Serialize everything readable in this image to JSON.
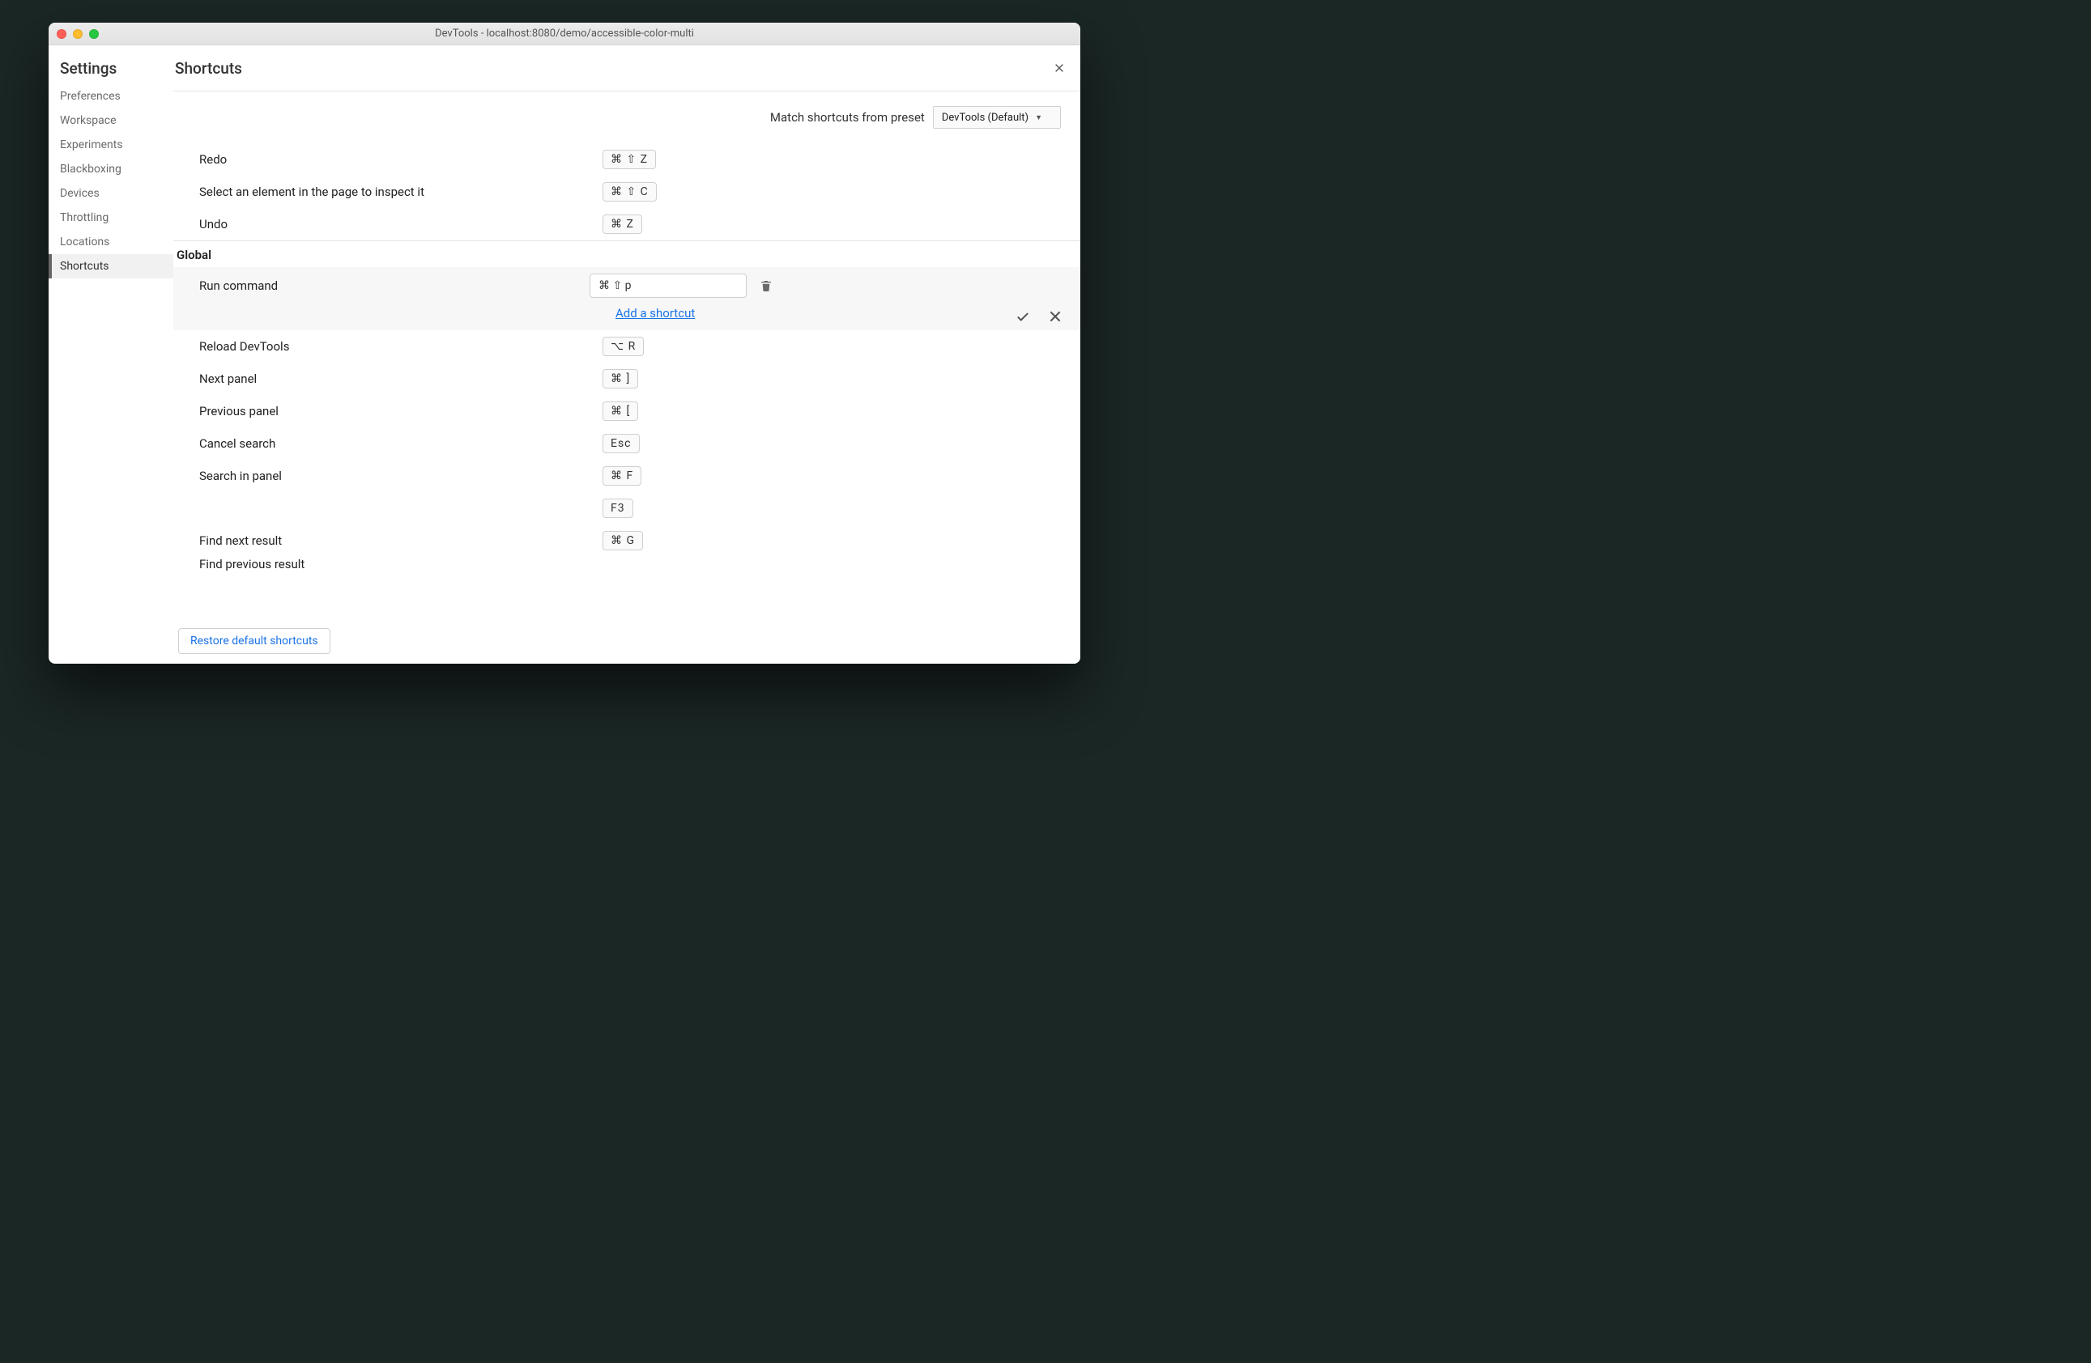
{
  "window": {
    "title": "DevTools - localhost:8080/demo/accessible-color-multi"
  },
  "sidebar": {
    "title": "Settings",
    "items": [
      "Preferences",
      "Workspace",
      "Experiments",
      "Blackboxing",
      "Devices",
      "Throttling",
      "Locations",
      "Shortcuts"
    ],
    "activeIndex": 7
  },
  "content": {
    "title": "Shortcuts",
    "preset": {
      "label": "Match shortcuts from preset",
      "selected": "DevTools (Default)"
    },
    "topRows": [
      {
        "label": "Redo",
        "keys": "⌘ ⇧ Z"
      },
      {
        "label": "Select an element in the page to inspect it",
        "keys": "⌘ ⇧ C"
      },
      {
        "label": "Undo",
        "keys": "⌘ Z"
      }
    ],
    "section": "Global",
    "edit": {
      "label": "Run command",
      "value": "⌘ ⇧ p",
      "addLink": "Add a shortcut"
    },
    "bottomRows": [
      {
        "label": "Reload DevTools",
        "keys": "⌥ R"
      },
      {
        "label": "Next panel",
        "keys": "⌘ ]"
      },
      {
        "label": "Previous panel",
        "keys": "⌘ ["
      },
      {
        "label": "Cancel search",
        "keys": "Esc"
      },
      {
        "label": "Search in panel",
        "keys": "⌘ F"
      },
      {
        "label": "",
        "keys": "F3"
      },
      {
        "label": "Find next result",
        "keys": "⌘ G"
      }
    ],
    "cutoff": "Find previous result",
    "restore": "Restore default shortcuts"
  }
}
